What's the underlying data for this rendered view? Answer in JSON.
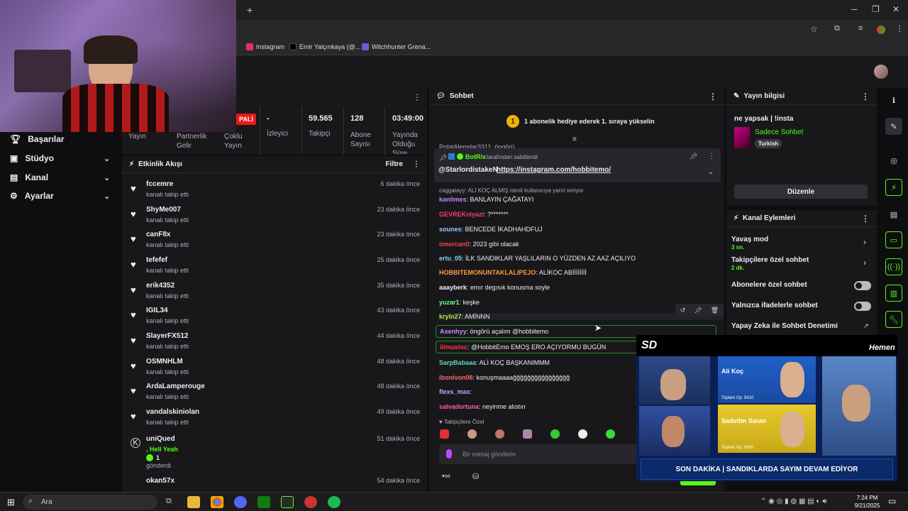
{
  "browser": {
    "new_tab": "+",
    "bookmarks": [
      {
        "label": "Instagram",
        "color": "#e1306c"
      },
      {
        "label": "Emir Yalçınkaya (@...",
        "color": "#000000"
      },
      {
        "label": "Witchhunter Grena...",
        "color": "#6b5bd6"
      }
    ]
  },
  "left_nav": {
    "items": [
      {
        "label": "Başarılar",
        "chev": ""
      },
      {
        "label": "Stüdyo",
        "chev": "⌄"
      },
      {
        "label": "Kanal",
        "chev": "⌄"
      },
      {
        "label": "Ayarlar",
        "chev": "⌄"
      }
    ]
  },
  "stats": {
    "live_badge": "PALİ",
    "yayin": "Yayın",
    "partnerlik": "Partnerlik Gelir",
    "coklu": "Çoklu Yayın",
    "viewers_val": "-",
    "viewers": "İzleyici",
    "followers_val": "59.565",
    "followers": "Takipçi",
    "subs_val": "128",
    "subs": "Abone Sayısı",
    "time_val": "03:49:00",
    "time": "Yayında Olduğu Süre"
  },
  "activity": {
    "title": "Etkinlik Akışı",
    "filter": "Filtre",
    "items": [
      {
        "name": "fccemre",
        "sub": "kanalı takip etti",
        "time": "6 dakika önce"
      },
      {
        "name": "ShyMe007",
        "sub": "kanalı takip etti",
        "time": "23 dakika önce"
      },
      {
        "name": "canF8x",
        "sub": "kanalı takip etti",
        "time": "23 dakika önce"
      },
      {
        "name": "tefefef",
        "sub": "kanalı takip etti",
        "time": "25 dakika önce"
      },
      {
        "name": "erik4352",
        "sub": "kanalı takip etti",
        "time": "35 dakika önce"
      },
      {
        "name": "IGIL34",
        "sub": "kanalı takip etti",
        "time": "43 dakika önce"
      },
      {
        "name": "SlayerFX512",
        "sub": "kanalı takip etti",
        "time": "44 dakika önce"
      },
      {
        "name": "OSMNHLM",
        "sub": "kanalı takip etti",
        "time": "48 dakika önce"
      },
      {
        "name": "ArdaLamperouge",
        "sub": "kanalı takip etti",
        "time": "48 dakika önce"
      },
      {
        "name": "vandalskiniolan",
        "sub": "kanalı takip etti",
        "time": "49 dakika önce"
      }
    ],
    "unique": {
      "name": "uniQued",
      "msg": ", Hell Yeah",
      "count": "1",
      "sent": "gönderdi",
      "time": "51 dakika önce"
    },
    "last": {
      "name": "okan57x",
      "time": "54 dakika önce"
    }
  },
  "chat": {
    "title": "Sohbet",
    "gift_num": "1",
    "gift_text": "1 abonelik hediye ederek 1. sıraya yükselin",
    "cut_user": "PolatAlemdar3311: öngörü",
    "pinned_by": "BotRix",
    "pinned_text": "tarafından sabitlendi",
    "pinned_user": "@StarlordistakeN",
    "pinned_link": "https://instagram.com/hobbitemo/",
    "reply": "caggatayy: ALİ KOÇ ALMIŞ isimli kullanıcıya yanıt veriyor",
    "messages": [
      {
        "user": "kaniimes",
        "text": ": BANLAYIN ÇAĞATAYI",
        "color": "#b98aff"
      },
      {
        "user": "GEVREKniyazi",
        "text": ": ?*******",
        "color": "#ff3b6b"
      },
      {
        "user": "sounes",
        "text": ": BENCEDE İKADHAHDFUJ",
        "color": "#9ec9ff"
      },
      {
        "user": "omercan0",
        "text": ": 2023 gibi olacak",
        "color": "#ff4040"
      },
      {
        "user": "ertu_05",
        "text": ": İLK SANDIKLAR YAŞLILARIN O YÜZDEN AZ AAZ AÇILIYO",
        "color": "#7fd6ff"
      },
      {
        "user": "HOBBITEMONUNTAKLALIPEJO",
        "text": ": ALİKOC ABİİİİİİİİ",
        "color": "#ff9a3c"
      },
      {
        "user": "aaayberk",
        "text": ": emır degısık konusma soyle",
        "color": "#efeff1"
      },
      {
        "user": "yuzar1",
        "text": ": keşke",
        "color": "#6cff8a"
      },
      {
        "user": "kryln27",
        "text": ": AMİNNN",
        "color": "#b7e04a"
      },
      {
        "user": "Asenhyy",
        "text": ": öngörü açalım @hobbitemo",
        "color": "#c28aff"
      },
      {
        "user": "iiimusloc",
        "text": ": @HobbitEmo EMOŞ ERO AÇIYORMU BUGÜN",
        "color": "#ff3b3b"
      },
      {
        "user": "SarpBabaaa",
        "text": ": ALİ KOÇ BAŞKANIMMM",
        "color": "#63d7a8"
      },
      {
        "user": "ibonivon06",
        "text": ": konuşmaaaağğğğğğğğğğğğğğğğ",
        "color": "#ff6a6a"
      },
      {
        "user": "flexs_max",
        "text": ":",
        "color": "#a7b4ff"
      },
      {
        "user": "salvadortuna",
        "text": ": neyinme alıstın",
        "color": "#ff5ca8"
      }
    ],
    "followers_only": "Takipçilere Özel",
    "placeholder": "Bir mesaj gönderin"
  },
  "stream_info": {
    "title": "Yayın bilgisi",
    "stream_title": "ne yapsak | !insta",
    "category": "Sadece Sohbet",
    "tag": "Turkish",
    "edit": "Düzenle"
  },
  "channel_actions": {
    "title": "Kanal Eylemleri",
    "items": [
      {
        "label": "Yavaş mod",
        "sub": "3 sn.",
        "kind": "chev"
      },
      {
        "label": "Takipçilere özel sohbet",
        "sub": "2 dk.",
        "kind": "chev"
      },
      {
        "label": "Abonelere özel sohbet",
        "sub": "",
        "kind": "toggle"
      },
      {
        "label": "Yalnızca ifadelerle sohbet",
        "sub": "",
        "kind": "toggle"
      },
      {
        "label": "Yapay Zeka ile Sohbet Denetimi",
        "sub": "",
        "kind": "ext"
      }
    ]
  },
  "overlay": {
    "logo": "SD",
    "brand": "Hemen",
    "people": [
      {
        "name": "Ali Koç",
        "score_label": "Toplam Oy:",
        "score": "5410"
      },
      {
        "name": "Sadettin Saran",
        "score_label": "Toplam Oy:",
        "score": "5650"
      }
    ],
    "ticker": "SON DAKİKA | SANDIKLARDA SAYIM DEVAM EDİYOR"
  },
  "taskbar": {
    "search": "Ara",
    "time": "7:24 PM",
    "date": "9/21/2025"
  }
}
